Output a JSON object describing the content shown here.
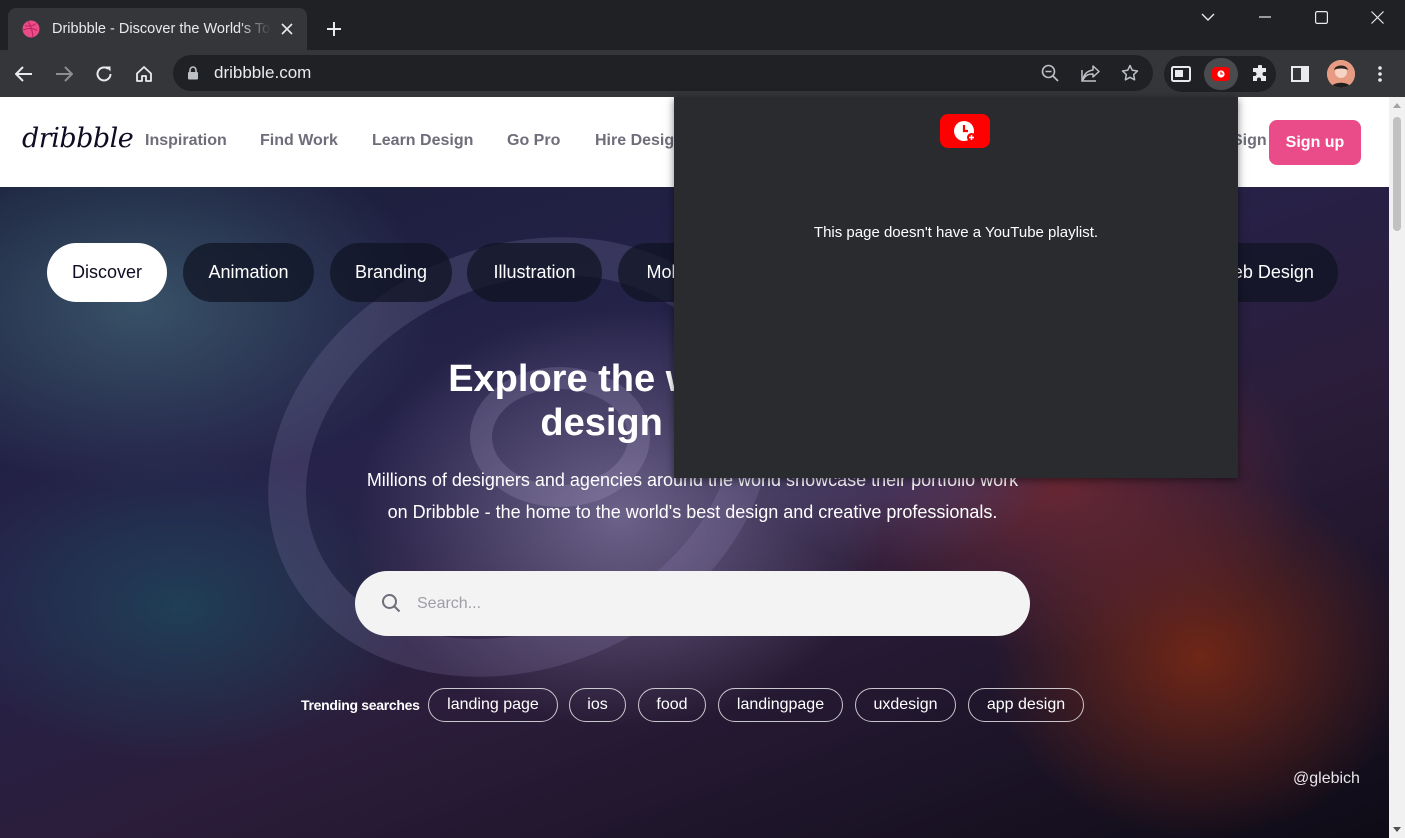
{
  "browser": {
    "tab_title": "Dribbble - Discover the World's Top Designers & Creative Professionals",
    "url": "dribbble.com",
    "accent": "#ea4c89"
  },
  "header": {
    "logo": "dribbble",
    "nav": [
      "Inspiration",
      "Find Work",
      "Learn Design",
      "Go Pro",
      "Hire Designers"
    ],
    "signin_label": "Sign in",
    "signup_label": "Sign up"
  },
  "hero": {
    "categories": [
      "Discover",
      "Animation",
      "Branding",
      "Illustration",
      "Mobile",
      "Web Design"
    ],
    "title_line1": "Explore the world's leading",
    "title_line2": "design portfolios",
    "subtitle_line1": "Millions of designers and agencies around the world showcase their portfolio work",
    "subtitle_line2": "on Dribbble - the home to the world's best design and creative professionals.",
    "search_placeholder": "Search...",
    "trending_label": "Trending searches",
    "trending": [
      "landing page",
      "ios",
      "food",
      "landingpage",
      "uxdesign",
      "app design"
    ],
    "credit": "@glebich"
  },
  "popup": {
    "message": "This page doesn't have a YouTube playlist.",
    "brand_color": "#ff0000"
  },
  "icons": [
    "dribbble-favicon-icon",
    "close-icon",
    "plus-icon",
    "chevron-down-icon",
    "minimize-icon",
    "maximize-icon",
    "close-window-icon",
    "back-icon",
    "forward-icon",
    "reload-icon",
    "home-icon",
    "lock-icon",
    "zoom-out-icon",
    "share-icon",
    "star-icon",
    "picture-in-picture-icon",
    "youtube-extension-icon",
    "puzzle-icon",
    "side-panel-icon",
    "kebab-menu-icon",
    "search-icon"
  ]
}
